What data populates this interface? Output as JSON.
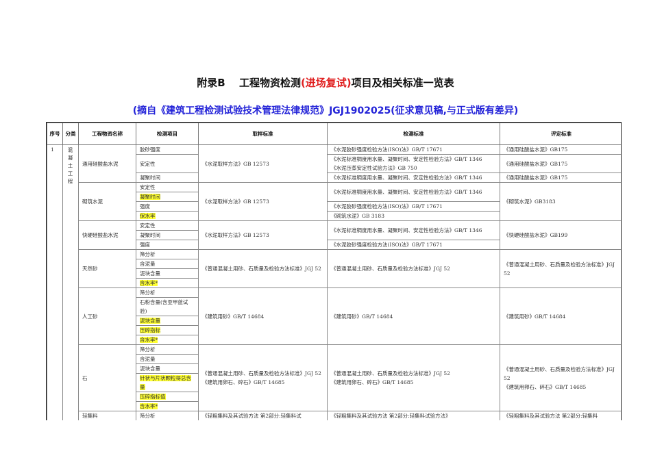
{
  "title": {
    "prefix": "附录B　 工程物资检测",
    "highlight": "(进场复试)",
    "suffix": "项目及相关标准一览表"
  },
  "subtitle": "(摘自《建筑工程检测试验技术管理法律规范》JGJ1902025(征求意见稿,与正式版有差异)",
  "headers": {
    "seq": "序号",
    "category": "分类",
    "name": "工程物资名称",
    "item": "检测项目",
    "sampling": "取样标准",
    "detection": "检测标准",
    "evaluation": "评定标准"
  },
  "seq": "1",
  "category": "混凝土工程",
  "colors": {
    "highlight": "#ffff33",
    "title_red": "#e02020",
    "subtitle_blue": "#2323d8"
  },
  "materials": [
    {
      "name": "通用硅酸盐水泥",
      "sampling": "《水泥取样方法》GB 12573",
      "items": [
        {
          "text": "胶砂强度",
          "units": 1
        },
        {
          "text": "安定性",
          "units": 2
        },
        {
          "text": "凝聚时间",
          "units": 1
        }
      ],
      "detection": [
        {
          "text": "《水泥胶砂强度检验方法(ISO)法》GB/T 17671",
          "units": 1
        },
        {
          "text": "《水泥标准稠度用水量、凝聚时间、安定性检验方法》GB/T 1346\n《水泥压蒸安定性试验方法》GB 750",
          "units": 2
        },
        {
          "text": "《水泥标准稠度用水量、凝聚时间、安定性检验方法》GB/T 1346",
          "units": 1
        }
      ],
      "evaluation": [
        {
          "text": "《通用硅酸盐水泥》GB175",
          "units": 1
        },
        {
          "text": "《通用硅酸盐水泥》GB175",
          "units": 2
        },
        {
          "text": "《通用硅酸盐水泥》GB175",
          "units": 1
        }
      ]
    },
    {
      "name": "砌筑水泥",
      "sampling": "《水泥取样方法》GB 12573",
      "items": [
        {
          "text": "安定性",
          "units": 1
        },
        {
          "text": "凝聚时间",
          "units": 1,
          "highlight": true
        },
        {
          "text": "强度",
          "units": 1
        },
        {
          "text": "保水率",
          "units": 1,
          "highlight": true
        }
      ],
      "detection": [
        {
          "text": "《水泥标准稠度用水量、凝聚时间、安定性检验方法》GB/T 1346",
          "units": 2
        },
        {
          "text": "《水泥胶砂强度检验方法(ISO)法》GB/T 17671",
          "units": 1
        },
        {
          "text": "《砌筑水泥》GB 3183",
          "units": 1
        }
      ],
      "evaluation": [
        {
          "text": "《砌筑水泥》GB3183",
          "units": 4
        }
      ]
    },
    {
      "name": "快硬硅酸盐水泥",
      "sampling": "《水泥取样方法》GB 12573",
      "items": [
        {
          "text": "安定性",
          "units": 1
        },
        {
          "text": "凝聚时间",
          "units": 1
        },
        {
          "text": "强度",
          "units": 1
        }
      ],
      "detection": [
        {
          "text": "《水泥标准稠度用水量、凝聚时间、安定性检验方法》GB/T 1346",
          "units": 2
        },
        {
          "text": "《水泥胶砂强度检验方法(ISO)法》GB/T 17671",
          "units": 1
        }
      ],
      "evaluation": [
        {
          "text": "《快硬硅酸盐水泥》GB199",
          "units": 3
        }
      ]
    },
    {
      "name": "天然砂",
      "sampling": "《普通混凝土用砂、石质量及检验方法标准》JGJ 52",
      "items": [
        {
          "text": "筛分析",
          "units": 1
        },
        {
          "text": "含泥量",
          "units": 1
        },
        {
          "text": "泥块含量",
          "units": 1
        },
        {
          "text": "含水率*",
          "units": 1,
          "highlight": true
        }
      ],
      "detection": [
        {
          "text": "《普通混凝土用砂、石质量及检验方法标准》JGJ 52",
          "units": 4
        }
      ],
      "evaluation": [
        {
          "text": "《普通混凝土用砂、石质量及检验方法标准》JGJ 52",
          "units": 4
        }
      ]
    },
    {
      "name": "人工砂",
      "sampling": "《建筑用砂》GB/T 14684",
      "items": [
        {
          "text": "筛分析",
          "units": 1
        },
        {
          "text": "石粉含量(含亚甲蓝试验)",
          "units": 2
        },
        {
          "text": "泥块含量",
          "units": 1,
          "highlight": true
        },
        {
          "text": "压碎指标",
          "units": 1,
          "highlight": true
        },
        {
          "text": "含水率*",
          "units": 1,
          "highlight": true
        }
      ],
      "detection": [
        {
          "text": "《建筑用砂》GB/T 14684",
          "units": 6
        }
      ],
      "evaluation": [
        {
          "text": "《建筑用砂》GB/T 14684",
          "units": 6
        }
      ]
    },
    {
      "name": "石",
      "sampling": "《普通混凝土用砂、石质量及检验方法标准》JGJ 52\n《建筑用卵石、碎石》GB/T 14685",
      "items": [
        {
          "text": "筛分析",
          "units": 1
        },
        {
          "text": "含泥量",
          "units": 1
        },
        {
          "text": "泥块含量",
          "units": 1
        },
        {
          "text": "针状与片状颗粒得总含量",
          "units": 2,
          "highlight": true
        },
        {
          "text": "压碎指标值",
          "units": 1,
          "highlight": true
        },
        {
          "text": "含水率*",
          "units": 1,
          "highlight": true
        }
      ],
      "detection": [
        {
          "text": "《普通混凝土用砂、石质量及检验方法标准》JGJ 52\n《建筑用卵石、碎石》GB/T 14685",
          "units": 7
        }
      ],
      "evaluation": [
        {
          "text": "《普通混凝土用砂、石质量及检验方法标准》JGJ 52\n《建筑用卵石、碎石》GB/T 14685",
          "units": 7
        }
      ]
    },
    {
      "name": "轻集料",
      "sampling": "《轻粗集料及其试验方法 第2部分:轻集料试",
      "items": [
        {
          "text": "筛分析",
          "units": 1
        }
      ],
      "detection": [
        {
          "text": "《轻粗集料及其试验方法 第2部分:轻集料试验方法》",
          "units": 1
        }
      ],
      "evaluation": [
        {
          "text": "《轻粗集料及其试验方法 第2部分:轻集料",
          "units": 1
        }
      ]
    }
  ]
}
